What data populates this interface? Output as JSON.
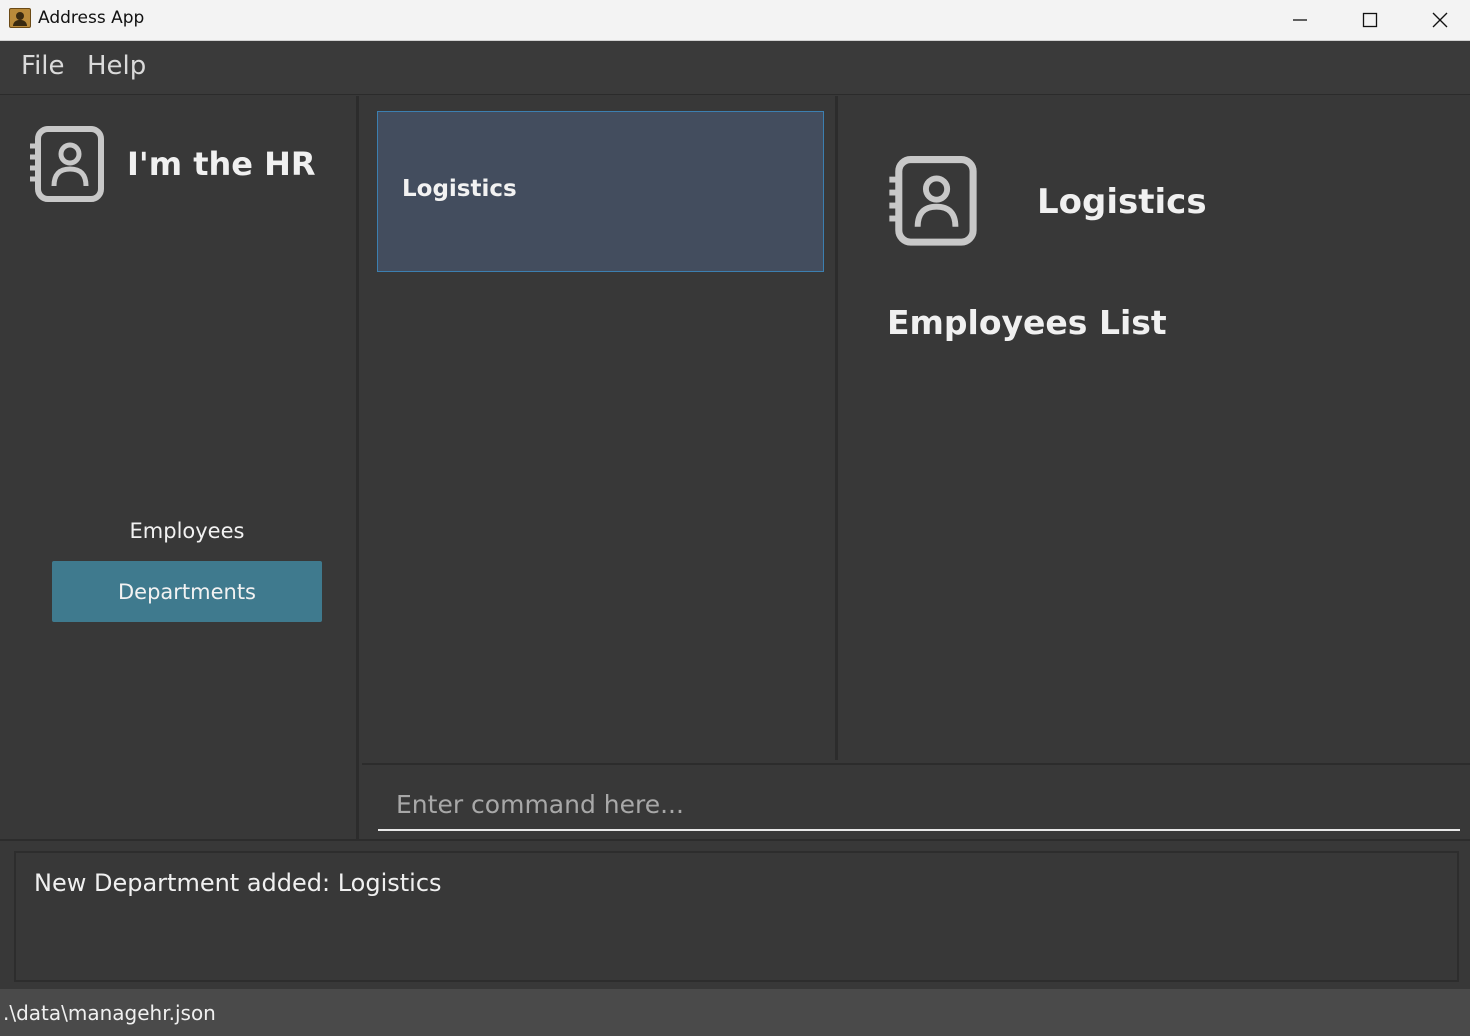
{
  "window": {
    "title": "Address App",
    "minimize_icon": "minimize-icon",
    "maximize_icon": "maximize-icon",
    "close_icon": "close-icon"
  },
  "menu": {
    "file": "File",
    "help": "Help"
  },
  "sidebar": {
    "app_name": "I'm the HR",
    "logo_icon": "address-book-icon",
    "nav": {
      "employees": "Employees",
      "departments": "Departments"
    },
    "active_color": "#3f7a8e"
  },
  "department_list": {
    "items": [
      {
        "name": "Logistics"
      }
    ],
    "selected_color": "#434d5e"
  },
  "detail": {
    "name": "Logistics",
    "section_title": "Employees List",
    "icon": "address-book-icon"
  },
  "command": {
    "placeholder": "Enter command here...",
    "value": ""
  },
  "result": {
    "message": "New Department added: Logistics"
  },
  "status": {
    "file_path": ".\\data\\managehr.json"
  }
}
